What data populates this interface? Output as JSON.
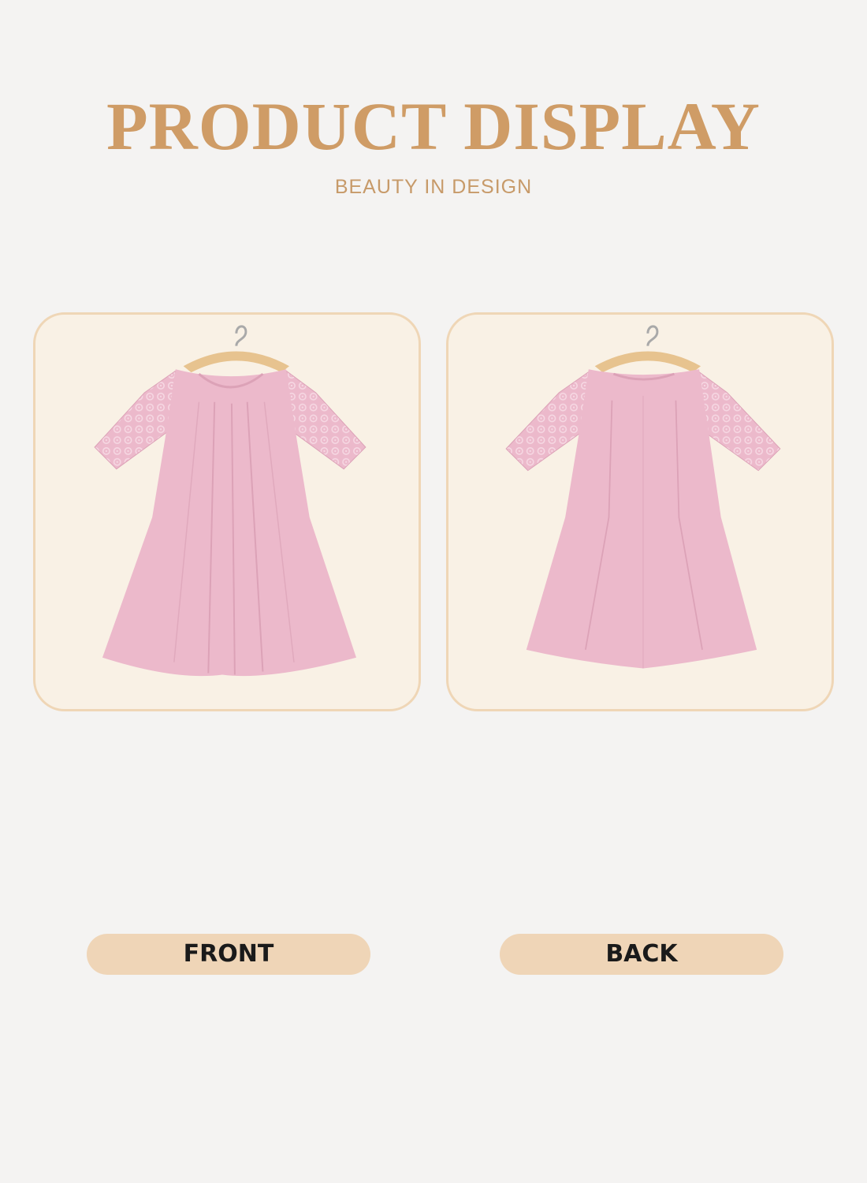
{
  "header": {
    "title": "PRODUCT DISPLAY",
    "subtitle": "BEAUTY IN DESIGN"
  },
  "views": {
    "front_label": "FRONT",
    "back_label": "BACK"
  },
  "colors": {
    "title": "#cf9c66",
    "subtitle": "#c79a69",
    "panel_border": "#efd6b6",
    "panel_fill": "#f9f1e5",
    "label_pill": "#efd5b7",
    "dress": "#ecb9cb",
    "dress_shadow": "#dca2b7",
    "hanger": "#e7c38f"
  },
  "images": {
    "front_icon": "dress-front-icon",
    "back_icon": "dress-back-icon"
  }
}
